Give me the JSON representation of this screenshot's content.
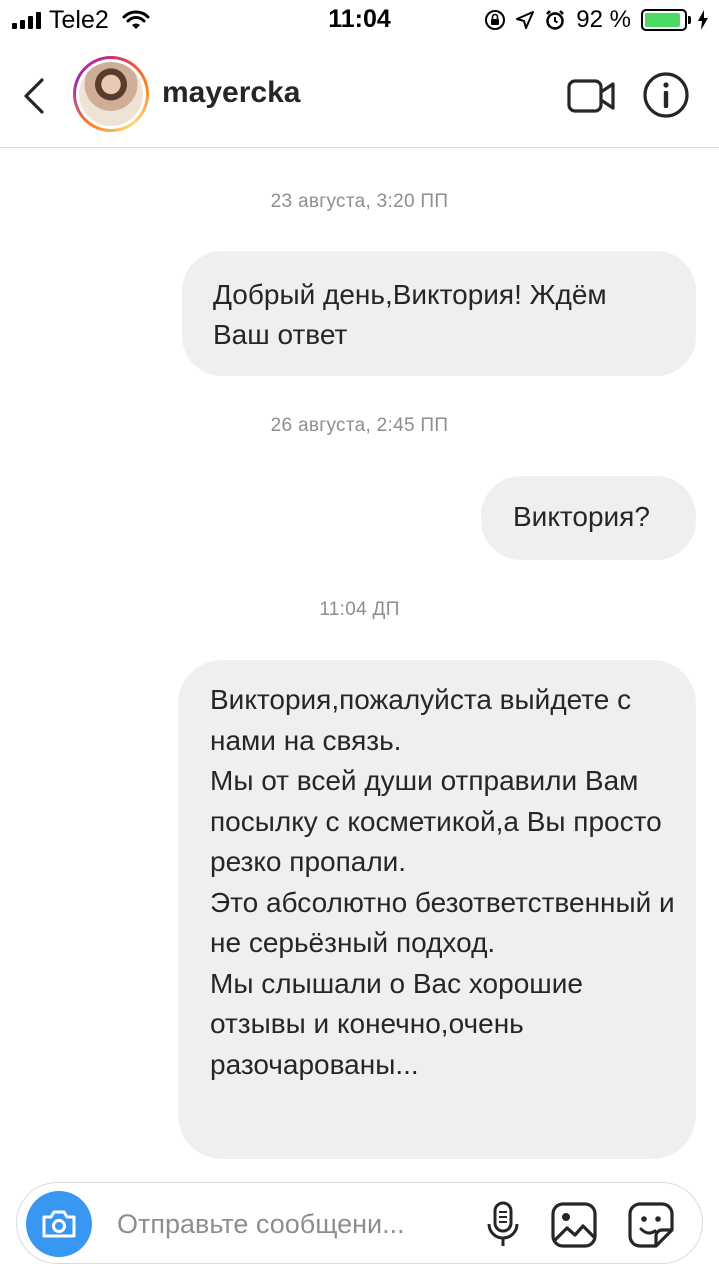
{
  "status_bar": {
    "carrier": "Tele2",
    "time": "11:04",
    "battery_percent": "92 %",
    "battery_level": 0.92,
    "battery_color": "#4cd964"
  },
  "header": {
    "username": "mayercka",
    "back_icon": "chevron-left-icon",
    "video_icon": "video-camera-icon",
    "info_icon": "info-icon"
  },
  "thread": {
    "messages": [
      {
        "timestamp": "23 августа, 3:20 ПП",
        "lines": [
          "Добрый день,Виктория! Ждём",
          "Ваш ответ"
        ]
      },
      {
        "timestamp": "26 августа, 2:45 ПП",
        "lines": [
          "Виктория?"
        ]
      },
      {
        "timestamp": "11:04 ДП",
        "paragraphs": [
          "Виктория,пожалуйста выйдете с нами на связь.",
          "Мы от всей души отправили Вам посылку с косметикой,а Вы просто резко пропали.",
          "Это абсолютно безответственный и не серьёзный подход.",
          "Мы слышали о Вас хорошие отзывы и конечно,очень разочарованы..."
        ]
      }
    ],
    "bubble_color": "#efefef"
  },
  "composer": {
    "placeholder": "Отправьте сообщени...",
    "camera_color": "#3897f0",
    "icons": [
      "camera-icon",
      "microphone-icon",
      "gallery-icon",
      "sticker-icon"
    ]
  }
}
